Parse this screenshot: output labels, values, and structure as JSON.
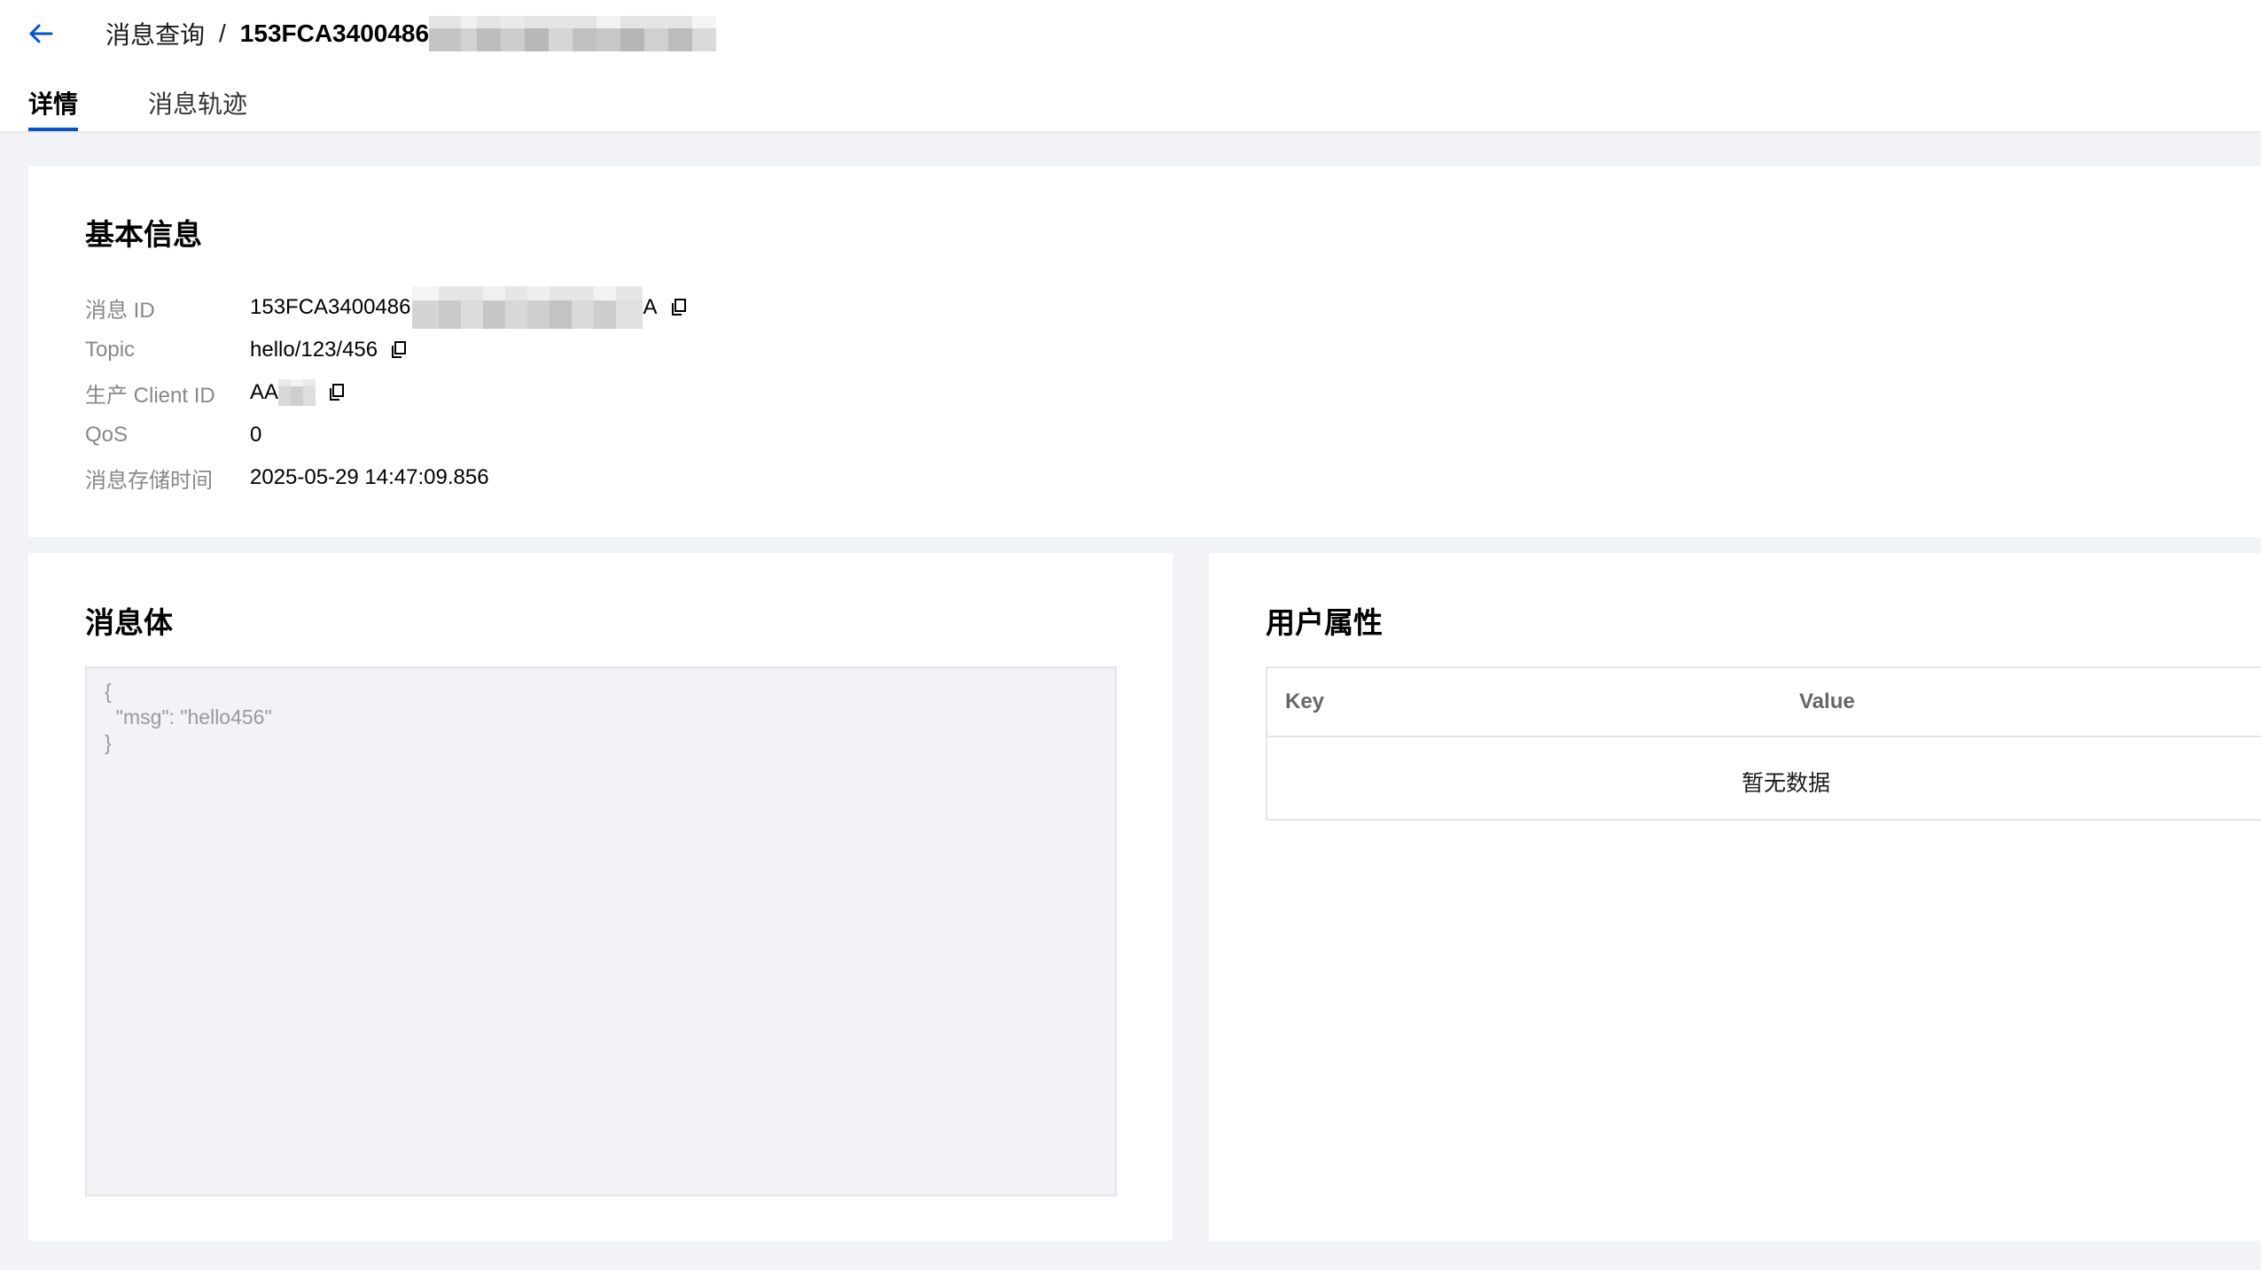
{
  "header": {
    "breadcrumb_parent": "消息查询",
    "breadcrumb_separator": "/",
    "breadcrumb_current": "153FCA3400486",
    "back_icon": "arrow-left-icon",
    "accent_color": "#0052d9"
  },
  "tabs": [
    {
      "label": "详情",
      "active": true
    },
    {
      "label": "消息轨迹",
      "active": false
    }
  ],
  "basic_info": {
    "title": "基本信息",
    "rows": [
      {
        "label": "消息 ID",
        "value": "153FCA3400486",
        "value_tail": "A",
        "copy_icon": "copy-icon"
      },
      {
        "label": "Topic",
        "value": "hello/123/456",
        "copy_icon": "copy-icon"
      },
      {
        "label": "生产 Client ID",
        "value": "AA",
        "copy_icon": "copy-icon"
      },
      {
        "label": "QoS",
        "value": "0"
      },
      {
        "label": "消息存储时间",
        "value": "2025-05-29 14:47:09.856"
      }
    ]
  },
  "message_body": {
    "title": "消息体",
    "content": "{\n  \"msg\": \"hello456\"\n}"
  },
  "user_properties": {
    "title": "用户属性",
    "columns": [
      "Key",
      "Value"
    ],
    "empty_text": "暂无数据"
  }
}
